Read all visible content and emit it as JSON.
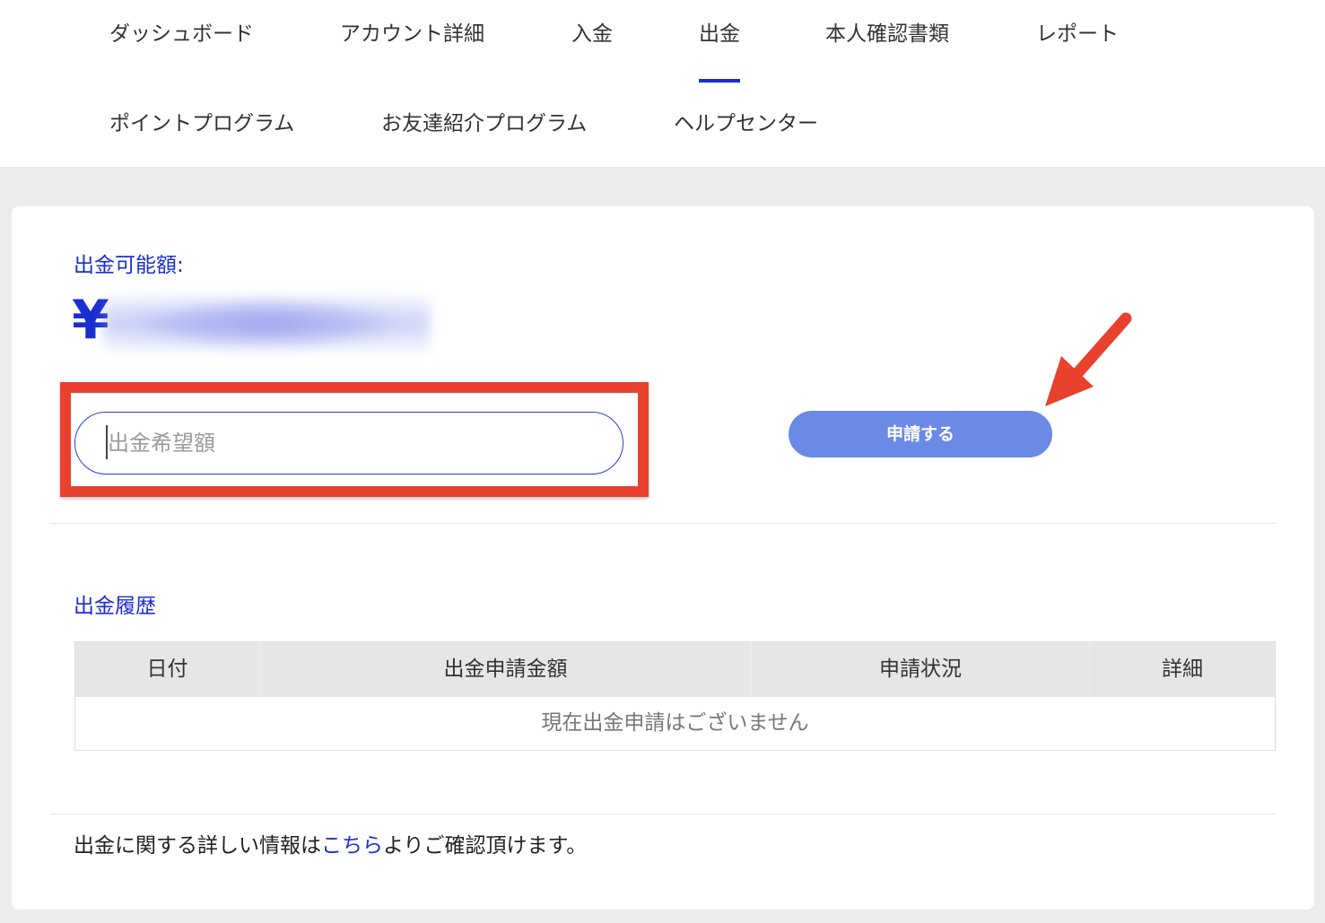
{
  "nav": {
    "row1": [
      "ダッシュボード",
      "アカウント詳細",
      "入金",
      "出金",
      "本人確認書類",
      "レポート"
    ],
    "row2": [
      "ポイントプログラム",
      "お友達紹介プログラム",
      "ヘルプセンター"
    ],
    "active": "出金"
  },
  "withdraw": {
    "available_label": "出金可能額:",
    "currency_symbol": "¥",
    "amount_placeholder": "出金希望額",
    "apply_button": "申請する"
  },
  "history": {
    "title": "出金履歴",
    "columns": [
      "日付",
      "出金申請金額",
      "申請状況",
      "詳細"
    ],
    "empty_message": "現在出金申請はございません"
  },
  "footer": {
    "text_before": "出金に関する詳しい情報は",
    "link_text": "こちら",
    "text_after": "よりご確認頂けます。"
  },
  "colors": {
    "accent": "#1a2ecf",
    "button": "#6b8ae6",
    "highlight": "#e8412e"
  }
}
